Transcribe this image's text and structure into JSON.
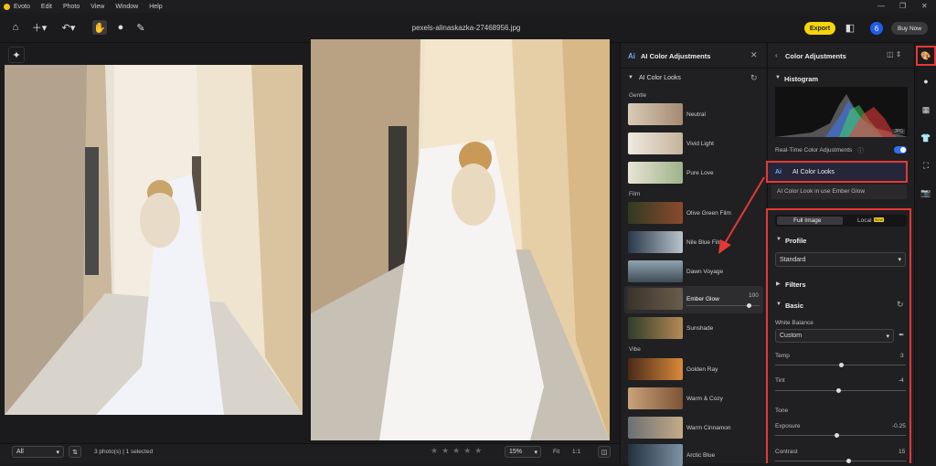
{
  "app": {
    "menu": [
      "Evoto",
      "Edit",
      "Photo",
      "View",
      "Window",
      "Help"
    ],
    "filename": "pexels-alinaskazka-27468956.jpg",
    "export_label": "Export",
    "avatar_letter": "6",
    "buy_now_label": "Buy Now"
  },
  "bottom": {
    "filter_value": "All",
    "photo_count": "3 photo(s) | 1 selected",
    "zoom_value": "15%",
    "fit_label": "Fit",
    "ratio_label": "1:1"
  },
  "looks_panel": {
    "title": "AI Color Adjustments",
    "section": "AI Color Looks",
    "categories": {
      "gentle": "Gentle",
      "film": "Film",
      "vibe": "Vibe"
    },
    "gentle_items": [
      "Neutral",
      "Vivid Light",
      "Pure Love"
    ],
    "film_items": [
      "Olive Green Film",
      "Nile Blue Film",
      "Dawn Voyage",
      "Ember Glow",
      "Sunshade"
    ],
    "vibe_items": [
      "Golden Ray",
      "Warm & Cozy",
      "Warm Cinnamon",
      "Arctic Blue"
    ],
    "selected_value": "100",
    "selected_level": 1.0
  },
  "adjust_panel": {
    "title": "Color Adjustments",
    "histogram_label": "Histogram",
    "histogram_badge": "JPG",
    "realtime_label": "Real-Time Color Adjustments",
    "ai_looks_label": "AI Color Looks",
    "ai_looks_status": "AI Color Look in use Ember Glow",
    "tab_full": "Full Image",
    "tab_local": "Local",
    "tab_local_badge": "New",
    "profile_label": "Profile",
    "profile_value": "Standard",
    "filters_label": "Filters",
    "basic_label": "Basic",
    "wb_label": "White Balance",
    "wb_value": "Custom",
    "temp_label": "Temp",
    "temp_value": "3",
    "tint_label": "Tint",
    "tint_value": "-4",
    "tone_label": "Tone",
    "exposure_label": "Exposure",
    "exposure_value": "-0.25",
    "contrast_label": "Contrast",
    "contrast_value": "15"
  },
  "colors": {
    "accent": "#e53935",
    "export": "#f5d50b",
    "toggle": "#2f6fea"
  }
}
